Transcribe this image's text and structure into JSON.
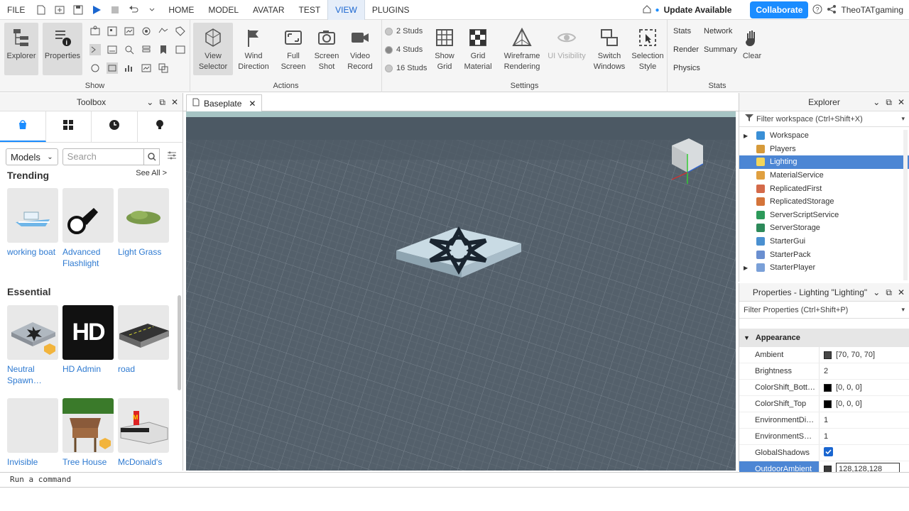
{
  "menubar": {
    "file": "FILE",
    "tabs": [
      "HOME",
      "MODEL",
      "AVATAR",
      "TEST",
      "VIEW",
      "PLUGINS"
    ],
    "active_tab": "VIEW",
    "update": "Update Available",
    "collaborate": "Collaborate",
    "username": "TheoTATgaming"
  },
  "ribbon": {
    "show": {
      "label": "Show",
      "explorer": "Explorer",
      "properties": "Properties"
    },
    "actions": {
      "label": "Actions",
      "view_selector": "View Selector",
      "wind_direction": "Wind Direction",
      "full_screen": "Full Screen",
      "screen_shot": "Screen Shot",
      "video_record": "Video Record"
    },
    "settings": {
      "label": "Settings",
      "studs": [
        "2 Studs",
        "4 Studs",
        "16 Studs"
      ],
      "show_grid": "Show Grid",
      "grid_material": "Grid Material",
      "wireframe": "Wireframe Rendering",
      "ui_visibility": "UI Visibility",
      "switch_windows": "Switch Windows",
      "selection_style": "Selection Style"
    },
    "stats": {
      "label": "Stats",
      "stats": "Stats",
      "network": "Network",
      "render": "Render",
      "summary": "Summary",
      "physics": "Physics",
      "clear": "Clear"
    }
  },
  "toolbox": {
    "title": "Toolbox",
    "category": "Models",
    "search_placeholder": "Search",
    "trending": "Trending",
    "see_all": "See All >",
    "trending_items": [
      "working boat",
      "Advanced Flashlight",
      "Light Grass"
    ],
    "essential": "Essential",
    "essential_items": [
      "Neutral Spawn…",
      "HD Admin",
      "road"
    ],
    "more_items": [
      "Invisible",
      "Tree House",
      "McDonald's"
    ],
    "hd_text": "HD"
  },
  "doc_tab": {
    "label": "Baseplate"
  },
  "explorer": {
    "title": "Explorer",
    "filter": "Filter workspace (Ctrl+Shift+X)",
    "items": [
      "Workspace",
      "Players",
      "Lighting",
      "MaterialService",
      "ReplicatedFirst",
      "ReplicatedStorage",
      "ServerScriptService",
      "ServerStorage",
      "StarterGui",
      "StarterPack",
      "StarterPlayer"
    ],
    "selected": "Lighting",
    "icon_colors": [
      "#3a8fd6",
      "#d69a3a",
      "#f3d65a",
      "#e0a040",
      "#d46a4a",
      "#d4743a",
      "#2d9a5a",
      "#2d8a5a",
      "#4a90d0",
      "#6a8fd0",
      "#7aa0d8"
    ]
  },
  "properties": {
    "title": "Properties - Lighting \"Lighting\"",
    "filter": "Filter Properties (Ctrl+Shift+P)",
    "category": "Appearance",
    "rows": [
      {
        "name": "Ambient",
        "value": "[70, 70, 70]",
        "swatch": "#464646"
      },
      {
        "name": "Brightness",
        "value": "2",
        "swatch": ""
      },
      {
        "name": "ColorShift_Bott…",
        "value": "[0, 0, 0]",
        "swatch": "#000000"
      },
      {
        "name": "ColorShift_Top",
        "value": "[0, 0, 0]",
        "swatch": "#000000"
      },
      {
        "name": "EnvironmentDi…",
        "value": "1",
        "swatch": ""
      },
      {
        "name": "EnvironmentS…",
        "value": "1",
        "swatch": ""
      },
      {
        "name": "GlobalShadows",
        "value": "",
        "swatch": ""
      },
      {
        "name": "OutdoorAmbient",
        "value": "128,128,128",
        "swatch": "#3a3a3a"
      }
    ]
  },
  "command_bar": {
    "placeholder": "Run a command"
  }
}
